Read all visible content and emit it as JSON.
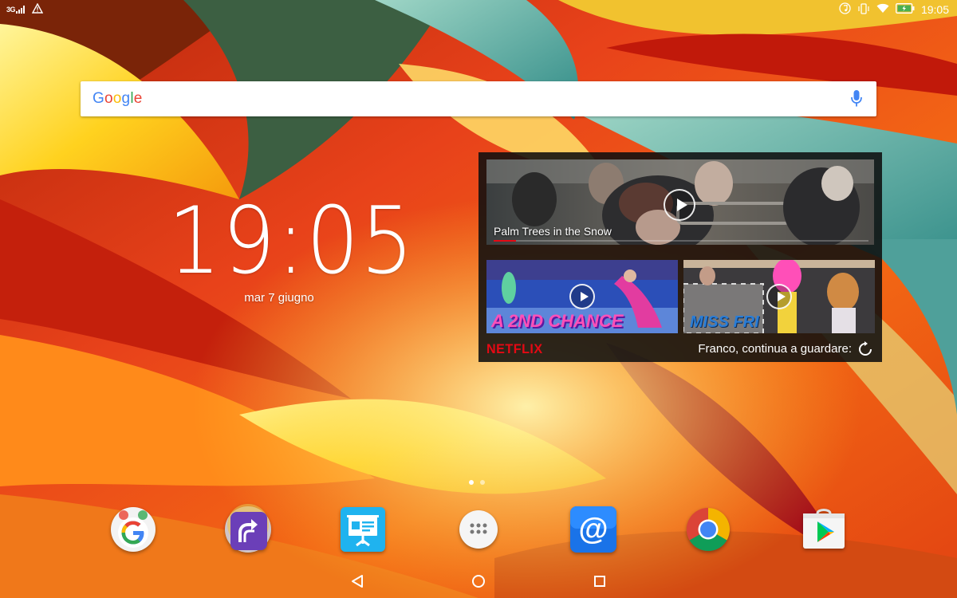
{
  "status_bar": {
    "network_label": "3G",
    "time": "19:05",
    "icons": [
      "signal-icon",
      "warning-icon",
      "music-icon",
      "vibrate-icon",
      "wifi-icon",
      "battery-charging-icon"
    ]
  },
  "search": {
    "logo_text": "Google",
    "mic_icon": "mic-icon"
  },
  "clock": {
    "time": "19:05",
    "date": "mar 7 giugno"
  },
  "netflix_widget": {
    "featured_title": "Palm Trees in the Snow",
    "featured_progress": 0.06,
    "thumbnails": [
      {
        "title_art": "A 2ND CHANCE"
      },
      {
        "title_art": "MISS FRI"
      }
    ],
    "brand": "NETFLIX",
    "prompt": "Franco, continua a guardare:",
    "refresh_icon": "refresh-icon"
  },
  "home_pages": {
    "count": 2,
    "active_index": 0
  },
  "dock": {
    "apps": [
      {
        "id": "google-folder",
        "icon": "google-g-icon"
      },
      {
        "id": "share-app",
        "icon": "share-arrow-icon"
      },
      {
        "id": "presentation-app",
        "icon": "presentation-icon"
      },
      {
        "id": "app-drawer",
        "icon": "app-drawer-icon"
      },
      {
        "id": "email-app",
        "icon": "at-sign-icon"
      },
      {
        "id": "chrome",
        "icon": "chrome-icon"
      },
      {
        "id": "play-store",
        "icon": "play-store-icon"
      }
    ]
  },
  "nav_bar": {
    "buttons": [
      "back-icon",
      "home-icon",
      "recents-icon"
    ]
  },
  "colors": {
    "netflix_red": "#e50914",
    "google_blue": "#4285F4",
    "google_red": "#EA4335",
    "google_yellow": "#FBBC05",
    "google_green": "#34A853"
  }
}
